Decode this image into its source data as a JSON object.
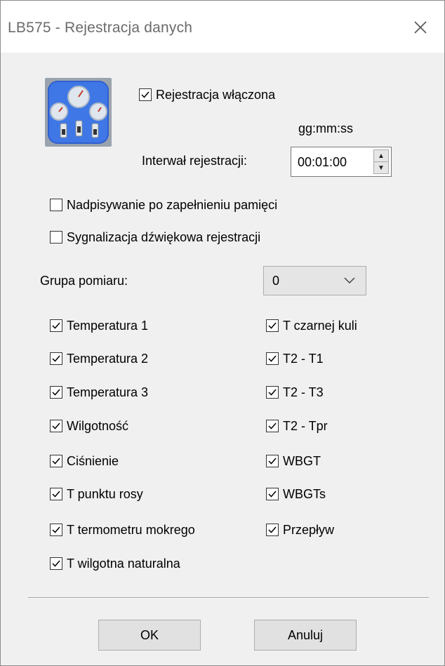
{
  "window": {
    "title": "LB575 - Rejestracja danych"
  },
  "registration": {
    "enabled_label": "Rejestracja włączona",
    "enabled": true,
    "format_hint": "gg:mm:ss",
    "interval_label": "Interwał rejestracji:",
    "interval_value": "00:01:00"
  },
  "options": {
    "overwrite_label": "Nadpisywanie po zapełnieniu pamięci",
    "overwrite": false,
    "sound_label": "Sygnalizacja dźwiękowa rejestracji",
    "sound": false
  },
  "group": {
    "label": "Grupa pomiaru:",
    "value": "0"
  },
  "channels_left": [
    {
      "label": "Temperatura 1",
      "checked": true
    },
    {
      "label": "Temperatura 2",
      "checked": true
    },
    {
      "label": "Temperatura 3",
      "checked": true
    },
    {
      "label": "Wilgotność",
      "checked": true
    },
    {
      "label": "Ciśnienie",
      "checked": true
    },
    {
      "label": "T punktu rosy",
      "checked": true
    },
    {
      "label": "T termometru mokrego",
      "checked": true
    },
    {
      "label": "T wilgotna naturalna",
      "checked": true
    }
  ],
  "channels_right": [
    {
      "label": "T czarnej kuli",
      "checked": true
    },
    {
      "label": "T2 - T1",
      "checked": true
    },
    {
      "label": "T2 - T3",
      "checked": true
    },
    {
      "label": "T2 - Tpr",
      "checked": true
    },
    {
      "label": "WBGT",
      "checked": true
    },
    {
      "label": "WBGTs",
      "checked": true
    },
    {
      "label": "Przepływ",
      "checked": true
    }
  ],
  "buttons": {
    "ok": "OK",
    "cancel": "Anuluj"
  },
  "icons": {
    "app": "gauges-icon",
    "close": "close-icon",
    "spin": "spin-arrows-icon",
    "combo": "chevron-down-icon"
  }
}
